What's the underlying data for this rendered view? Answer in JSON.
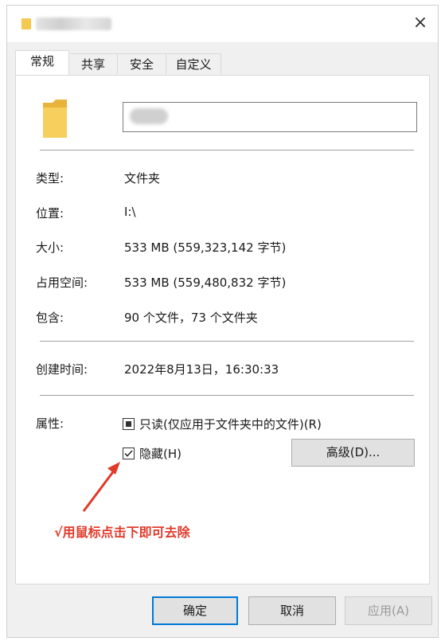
{
  "titlebar": {
    "close_icon": "×"
  },
  "tabs": [
    "常规",
    "共享",
    "安全",
    "自定义"
  ],
  "info": {
    "type_label": "类型:",
    "type_value": "文件夹",
    "location_label": "位置:",
    "location_value": "I:\\",
    "size_label": "大小:",
    "size_value": "533 MB (559,323,142 字节)",
    "disk_label": "占用空间:",
    "disk_value": "533 MB (559,480,832 字节)",
    "contains_label": "包含:",
    "contains_value": "90 个文件，73 个文件夹",
    "created_label": "创建时间:",
    "created_value": "2022年8月13日，16:30:33",
    "attrs_label": "属性:"
  },
  "attributes": {
    "readonly_label": "只读(仅应用于文件夹中的文件)(R)",
    "readonly_state": "indeterminate",
    "hidden_label": "隐藏(H)",
    "hidden_state": "checked",
    "advanced_button": "高级(D)..."
  },
  "annotation": "√用鼠标点击下即可去除",
  "footer": {
    "ok": "确定",
    "cancel": "取消",
    "apply": "应用(A)"
  },
  "colors": {
    "accent": "#0078d7",
    "annotation": "#e03a2a",
    "folder": "#f5c850"
  }
}
